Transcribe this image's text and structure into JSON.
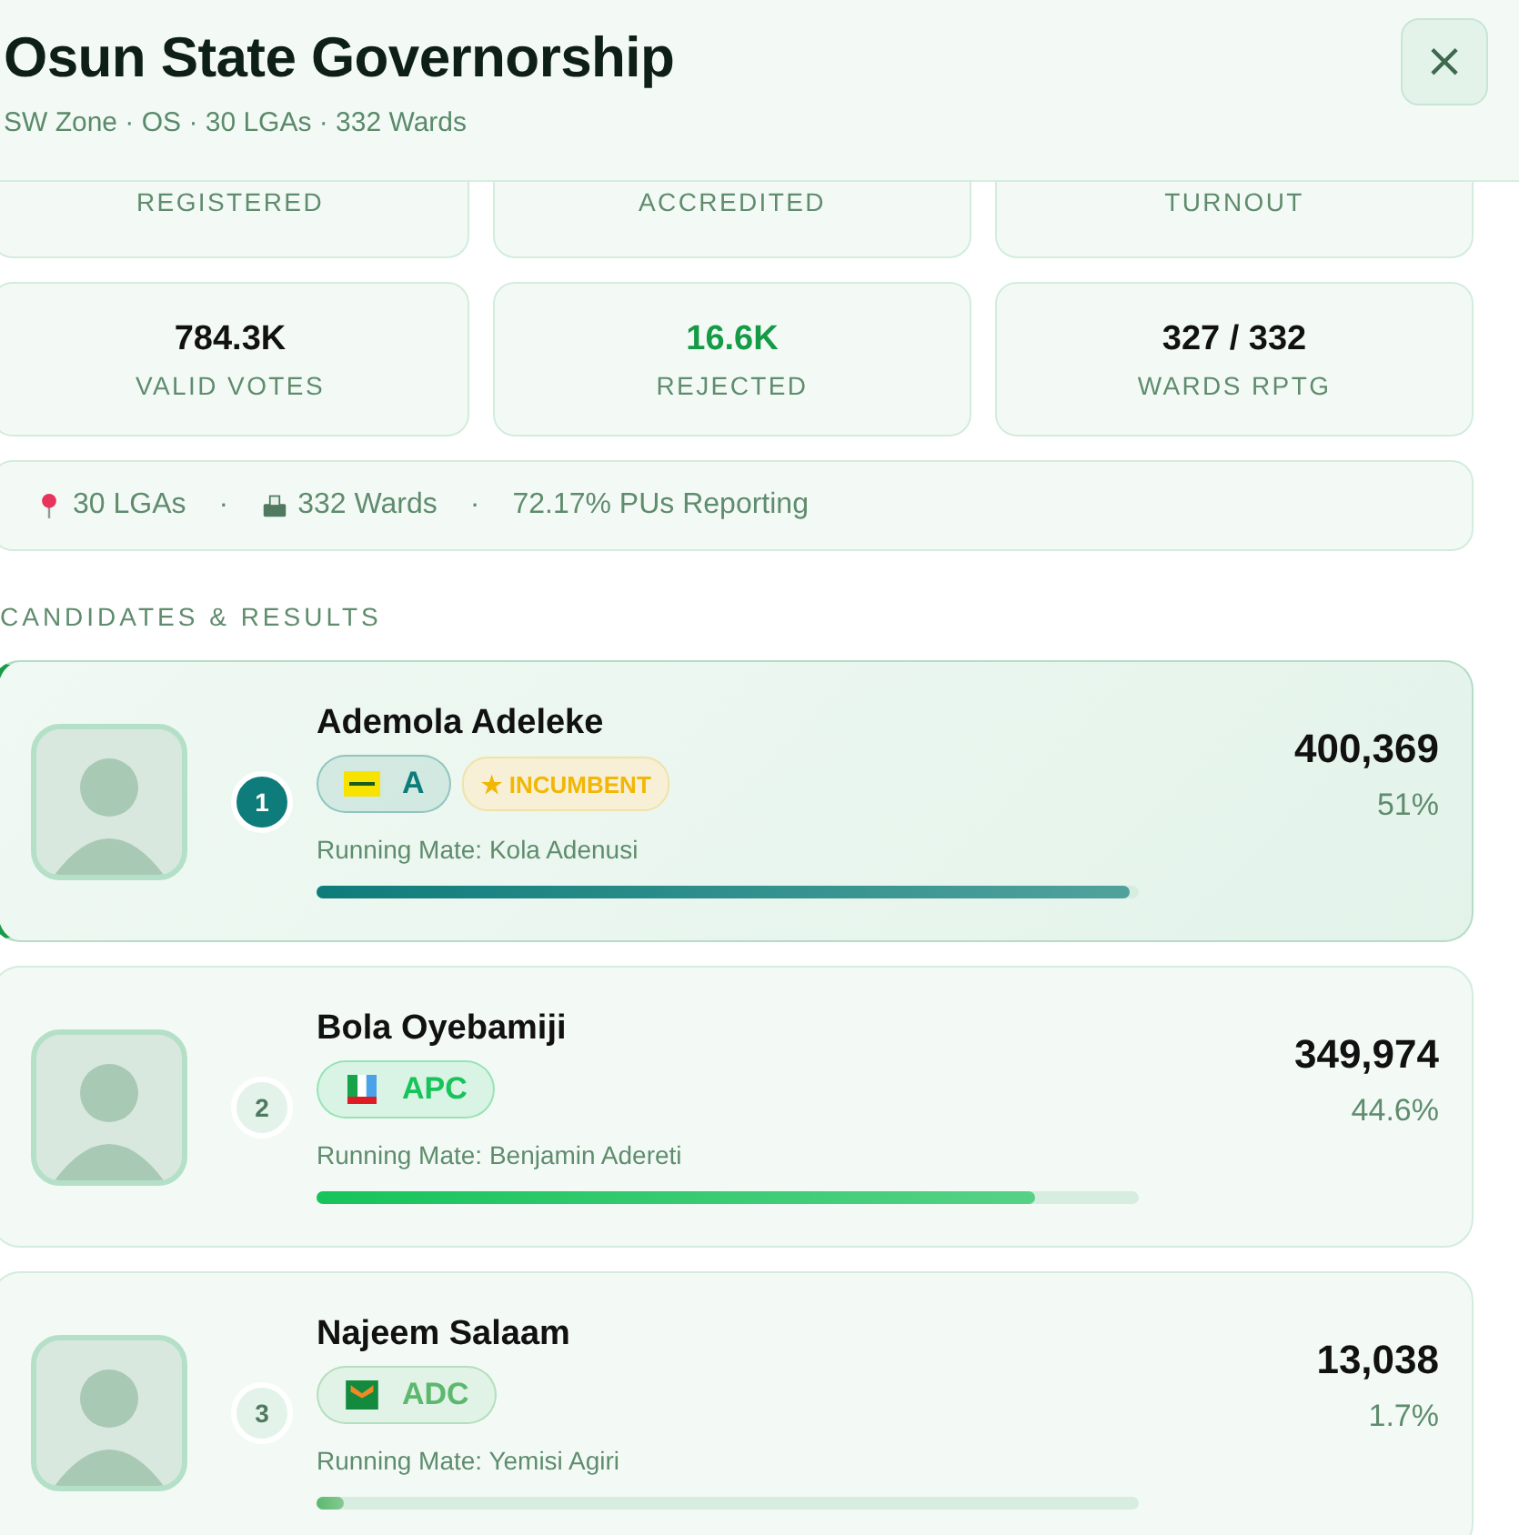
{
  "header": {
    "title": "Osun State Governorship",
    "subtitle": "SW Zone · OS · 30 LGAs · 332 Wards",
    "close": "×"
  },
  "stats_top": [
    {
      "label": "REGISTERED"
    },
    {
      "label": "ACCREDITED"
    },
    {
      "label": "TURNOUT"
    }
  ],
  "stats": [
    {
      "value": "784.3K",
      "label": "VALID VOTES",
      "kind": "plain"
    },
    {
      "value": "16.6K",
      "label": "REJECTED",
      "kind": "accent"
    },
    {
      "value": "327 / 332",
      "label": "WARDS RPTG",
      "kind": "plain"
    }
  ],
  "info_bar": {
    "separator": "·",
    "items": [
      {
        "kind": "pin",
        "text": "30 LGAs"
      },
      {
        "kind": "ballot",
        "text": "332 Wards"
      },
      {
        "kind": "none",
        "text": "72.17% PUs Reporting"
      }
    ]
  },
  "section_title": "CANDIDATES & RESULTS",
  "candidates": [
    {
      "rank": "1",
      "name": "Ademola Adeleke",
      "party": "A",
      "kind": "accord",
      "color": "#0e7c7b",
      "incumbent": true,
      "incumbent_label": "★ INCUMBENT",
      "running_mate": "Running Mate: Kola Adenusi",
      "votes": "400,369",
      "percent": "51%",
      "level": 0.99,
      "leading": true
    },
    {
      "rank": "2",
      "name": "Bola Oyebamiji",
      "party": "APC",
      "kind": "apc",
      "color": "#16c45a",
      "incumbent": false,
      "running_mate": "Running Mate: Benjamin Adereti",
      "votes": "349,974",
      "percent": "44.6%",
      "level": 0.874,
      "leading": false
    },
    {
      "rank": "3",
      "name": "Najeem Salaam",
      "party": "ADC",
      "kind": "adc",
      "color": "#5cb86e",
      "incumbent": false,
      "running_mate": "Running Mate: Yemisi Agiri",
      "votes": "13,038",
      "percent": "1.7%",
      "level": 0.033,
      "leading": false
    }
  ]
}
